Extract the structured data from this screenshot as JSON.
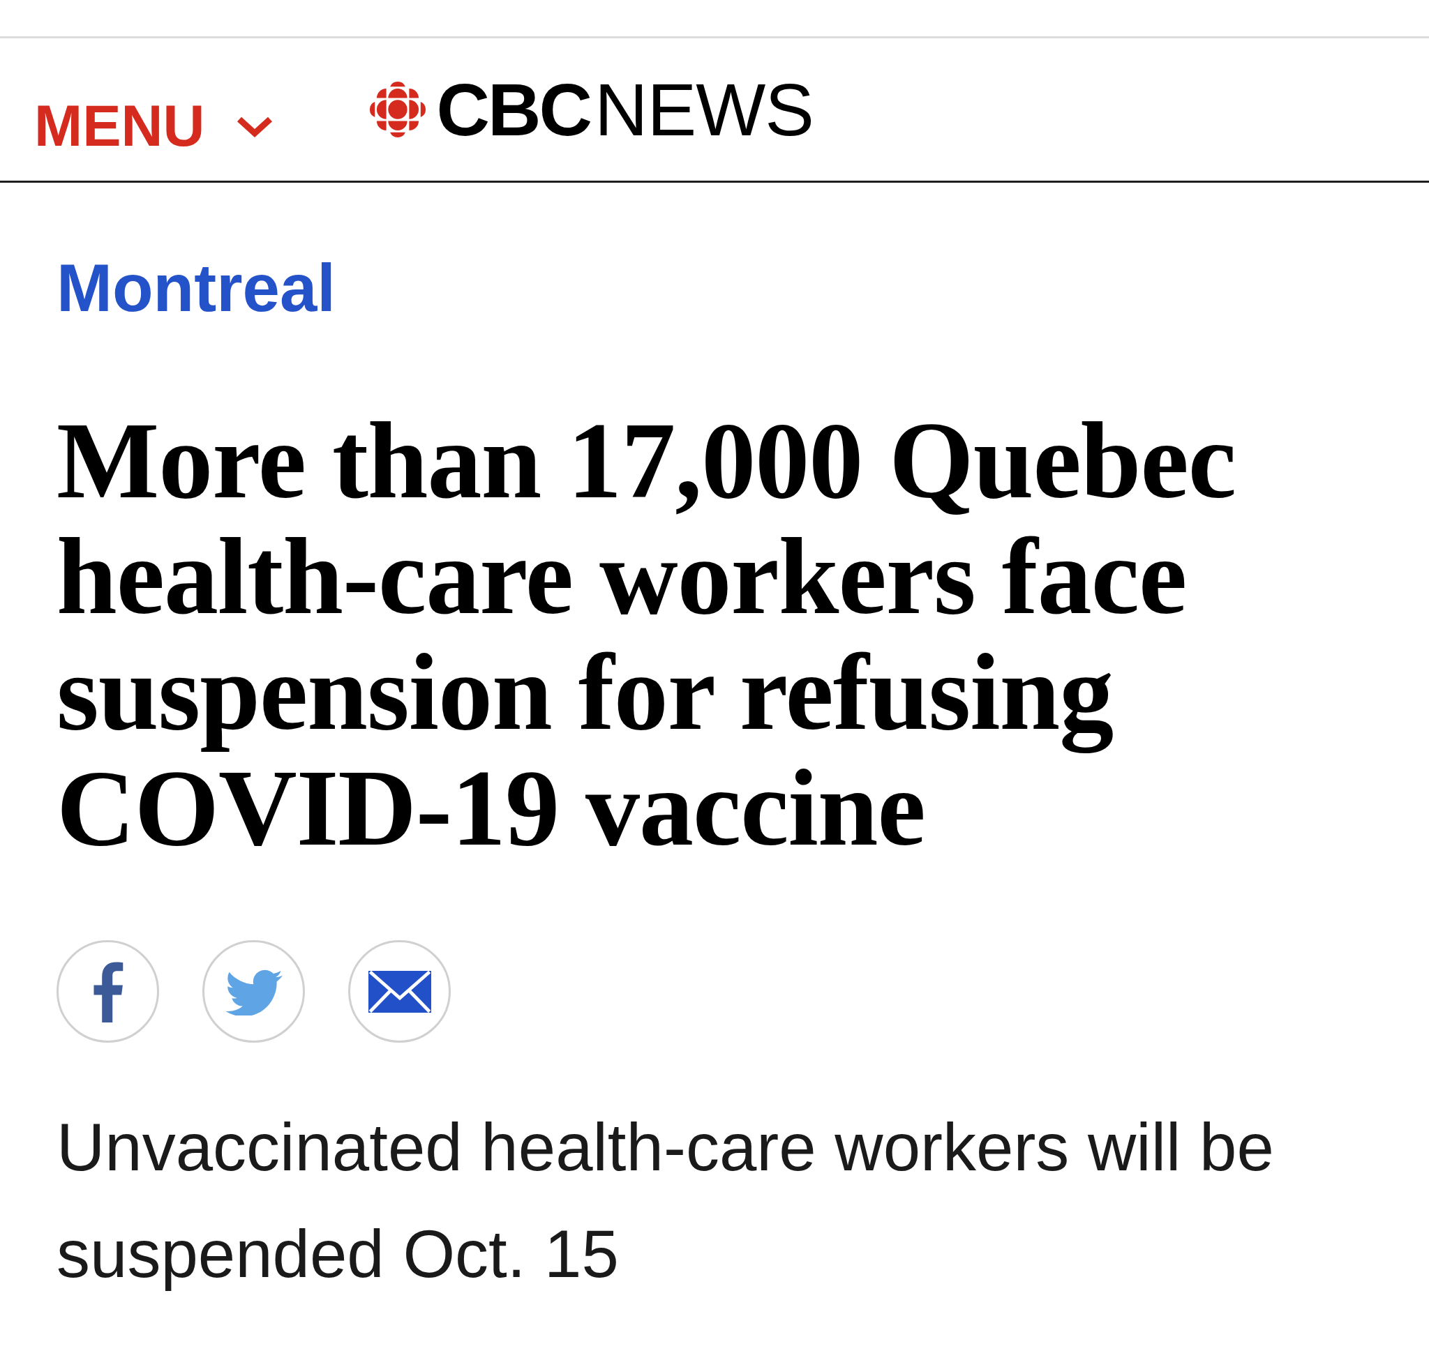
{
  "header": {
    "menu": {
      "label": "MENU",
      "expanded": false
    },
    "logo": {
      "wordmark": "**CBC**NEWS"
    }
  },
  "section": "Montreal",
  "headline": "More than 17,000 Quebec health-care workers face suspension for refusing COVID-19 vaccine",
  "share_buttons": [
    {
      "kind": "facebook"
    },
    {
      "kind": "twitter"
    },
    {
      "kind": "email"
    }
  ],
  "subhead": "Unvaccinated health-care workers will be suspended Oct. 15"
}
